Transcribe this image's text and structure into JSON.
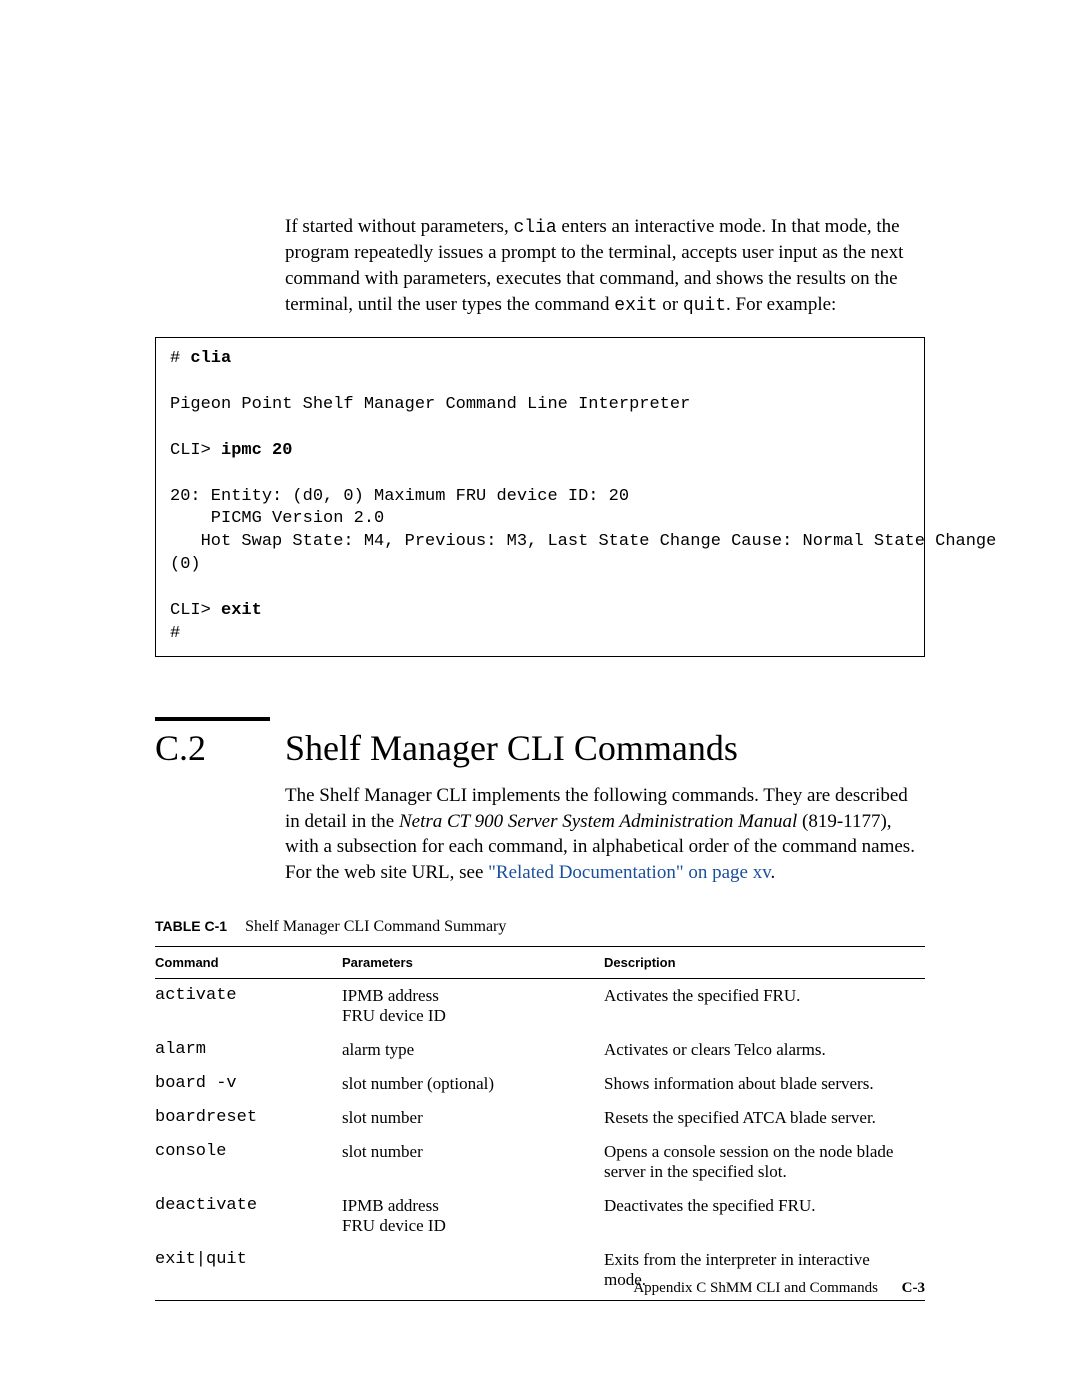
{
  "intro": {
    "pre_clia": "If started without parameters, ",
    "clia": "clia",
    "after_clia": " enters an interactive mode. In that mode, the program repeatedly issues a prompt to the terminal, accepts user input as the next command with parameters, executes that command, and shows the results on the terminal, until the user types the command ",
    "exit": "exit",
    "or": " or ",
    "quit": "quit",
    "tail": ". For example:"
  },
  "code": {
    "l1a": "# ",
    "l1b": "clia",
    "l2": "",
    "l3": "Pigeon Point Shelf Manager Command Line Interpreter",
    "l4": "",
    "l5a": "CLI> ",
    "l5b": "ipmc 20",
    "l6": "",
    "l7": "20: Entity: (d0, 0) Maximum FRU device ID: 20",
    "l8": "    PICMG Version 2.0",
    "l9": "   Hot Swap State: M4, Previous: M3, Last State Change Cause: Normal State Change",
    "l10": "(0)",
    "l11": "",
    "l12a": "CLI> ",
    "l12b": "exit",
    "l13": "#"
  },
  "section": {
    "num": "C.2",
    "title": "Shelf Manager CLI Commands",
    "p_pre": "The Shelf Manager CLI implements the following commands. They are described in detail in the ",
    "p_ital": "Netra CT 900 Server System Administration Manual",
    "p_mid": " (819-1177), with a subsection for each command, in alphabetical order of the command names. For the web site URL, see ",
    "p_link": "\"Related Documentation\" on page xv",
    "p_end": "."
  },
  "table": {
    "caption_label": "TABLE C-1",
    "caption_text": "Shelf Manager CLI Command Summary",
    "head": {
      "c1": "Command",
      "c2": "Parameters",
      "c3": "Description"
    },
    "rows": [
      {
        "cmd": "activate",
        "params": "IPMB address\nFRU device ID",
        "desc": "Activates the specified FRU."
      },
      {
        "cmd": "alarm",
        "params": "alarm type",
        "desc": "Activates or clears Telco alarms."
      },
      {
        "cmd": "board -v",
        "params": "slot number (optional)",
        "desc": "Shows information about blade servers."
      },
      {
        "cmd": "boardreset",
        "params": "slot number",
        "desc": "Resets the specified ATCA blade server."
      },
      {
        "cmd": "console",
        "params": "slot number",
        "desc": "Opens a console session on the node blade server in the specified slot."
      },
      {
        "cmd": "deactivate",
        "params": "IPMB address\nFRU device ID",
        "desc": "Deactivates the specified FRU."
      },
      {
        "cmd": "exit|quit",
        "params": "",
        "desc": "Exits from the interpreter in interactive mode."
      }
    ]
  },
  "footer": {
    "text": "Appendix C    ShMM CLI and Commands",
    "page": "C-3"
  }
}
